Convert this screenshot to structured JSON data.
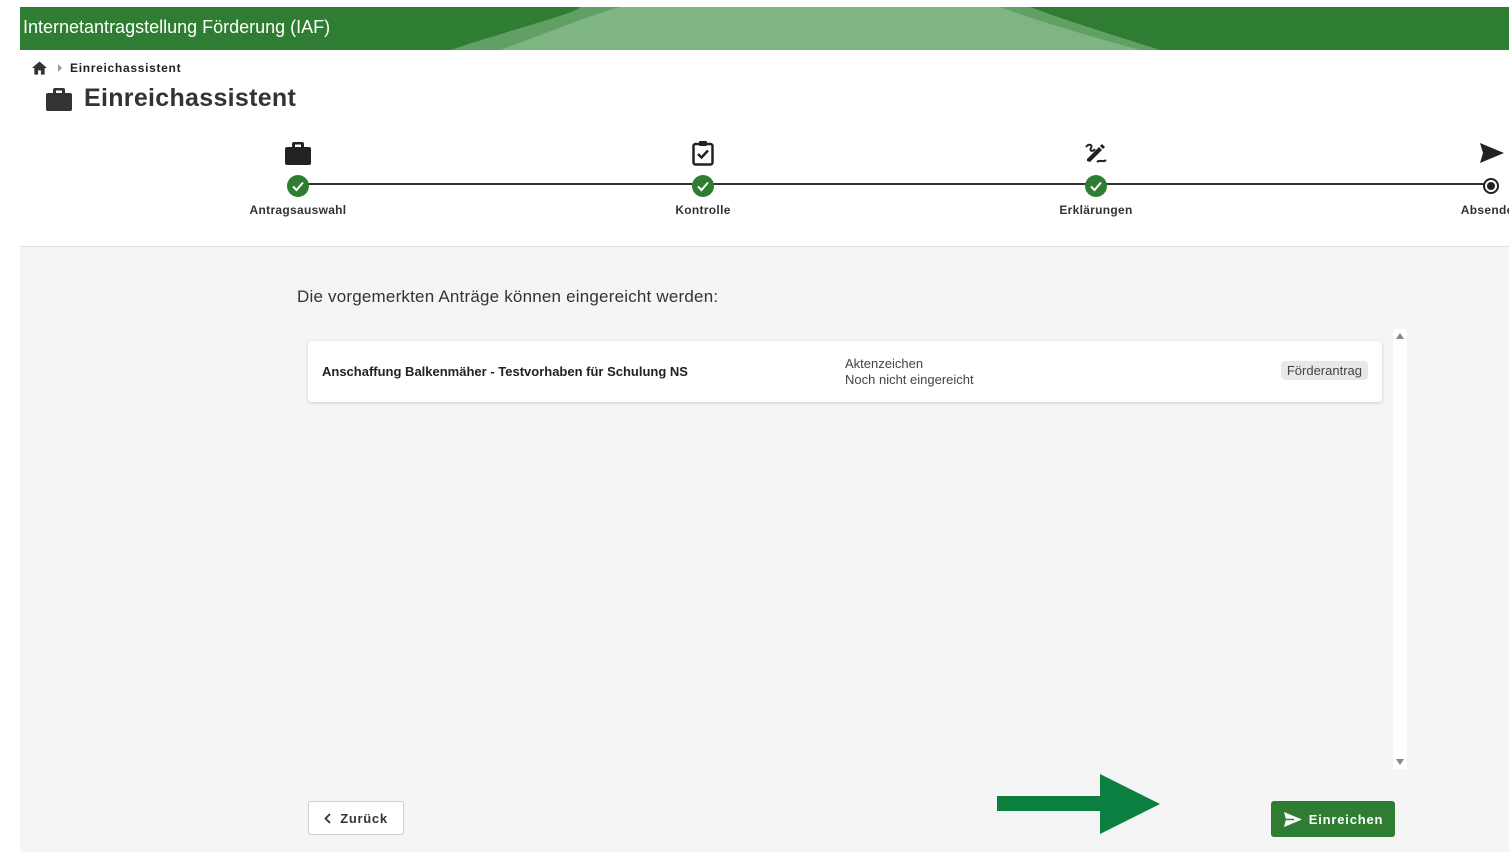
{
  "app": {
    "title": "Internetantragstellung Förderung (IAF)"
  },
  "breadcrumb": {
    "items": [
      "Einreichassistent"
    ]
  },
  "page": {
    "title": "Einreichassistent"
  },
  "stepper": {
    "steps": [
      {
        "label": "Antragsauswahl",
        "icon": "briefcase-icon",
        "status": "done"
      },
      {
        "label": "Kontrolle",
        "icon": "clipboard-check-icon",
        "status": "done"
      },
      {
        "label": "Erklärungen",
        "icon": "signature-icon",
        "status": "done"
      },
      {
        "label": "Absenden",
        "icon": "send-icon",
        "status": "current"
      }
    ]
  },
  "main": {
    "intro": "Die vorgemerkten Anträge können eingereicht werden:",
    "applications": [
      {
        "name": "Anschaffung Balkenmäher - Testvorhaben für Schulung NS",
        "aktenzeichen_label": "Aktenzeichen",
        "status": "Noch nicht eingereicht",
        "type": "Förderantrag"
      }
    ]
  },
  "actions": {
    "back_label": "Zurück",
    "submit_label": "Einreichen"
  },
  "colors": {
    "brand_green": "#2e7d32",
    "arrow_green": "#0a7f3f"
  }
}
